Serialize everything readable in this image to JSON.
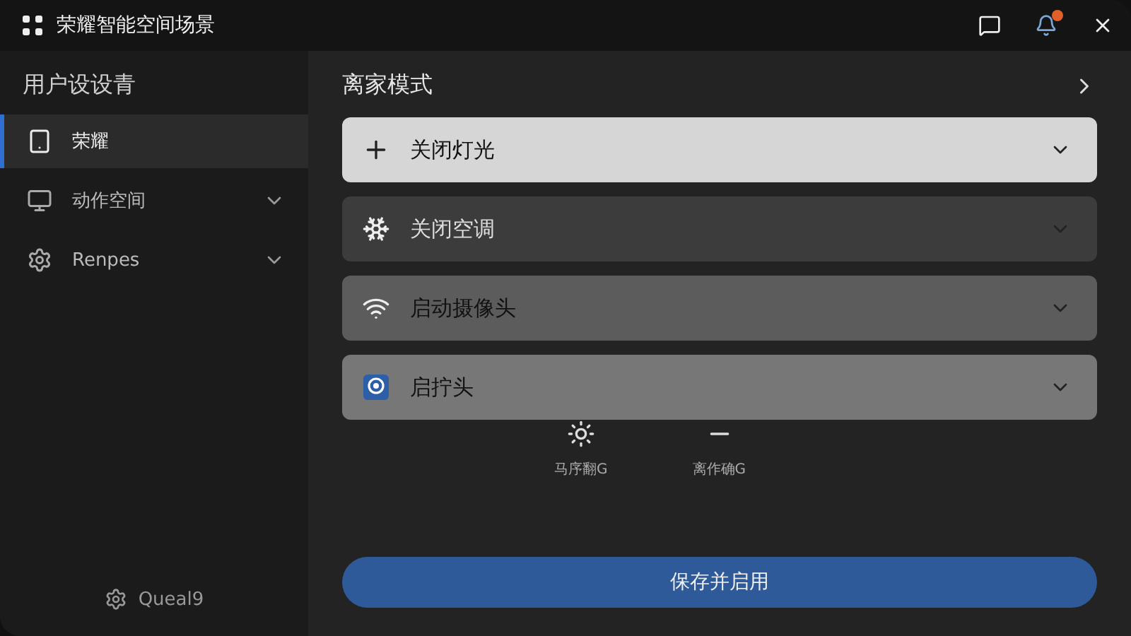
{
  "window": {
    "title": "荣耀智能空间场景"
  },
  "sidebar": {
    "heading": "用户设设青",
    "items": [
      {
        "label": "荣耀",
        "kind": "link",
        "selected": true
      },
      {
        "label": "动作空间",
        "kind": "group",
        "selected": false
      },
      {
        "label": "Renpes",
        "kind": "group",
        "selected": false
      }
    ],
    "footer": {
      "label": "Queal9"
    }
  },
  "main": {
    "title": "离家模式",
    "actions": [
      {
        "label": "关闭灯光",
        "color": "#d6d6d6"
      },
      {
        "label": "关闭空调",
        "color": "#3c3c3c"
      },
      {
        "label": "启动摄像头",
        "color": "#5c5c5c"
      },
      {
        "label": "启拧头",
        "color": "#777777"
      }
    ],
    "shortcuts": [
      {
        "label": "马序翻G"
      },
      {
        "label": "离作确G"
      }
    ],
    "save_button": "保存并启用"
  }
}
